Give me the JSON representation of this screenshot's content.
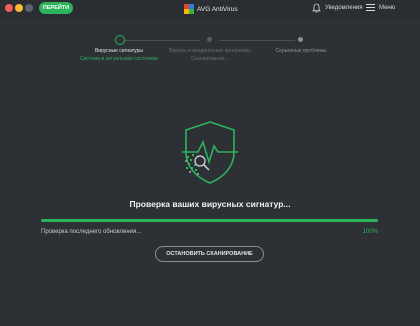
{
  "titlebar": {
    "go_label": "ПЕРЕЙТИ",
    "app_title": "AVG AntiVirus",
    "notifications_label": "Уведомления",
    "menu_label": "Меню"
  },
  "steps": [
    {
      "title": "Вирусные сигнатуры",
      "subtitle": "Система в актуальном состоянии"
    },
    {
      "title": "Вирусы и вредоносные программы",
      "subtitle": "Сканирование..."
    },
    {
      "title": "Серьезные проблемы",
      "subtitle": ""
    }
  ],
  "scan": {
    "title": "Проверка ваших вирусных сигнатур...",
    "status_text": "Проверка последнего обновления...",
    "percent_text": "100%",
    "progress_fraction": 1.0,
    "stop_label": "ОСТАНОВИТЬ СКАНИРОВАНИЕ"
  },
  "colors": {
    "accent": "#2cb35b",
    "background": "#2d3035"
  },
  "icons": [
    "avg-logo-icon",
    "bell-icon",
    "hamburger-icon",
    "shield-heartbeat-icon"
  ]
}
